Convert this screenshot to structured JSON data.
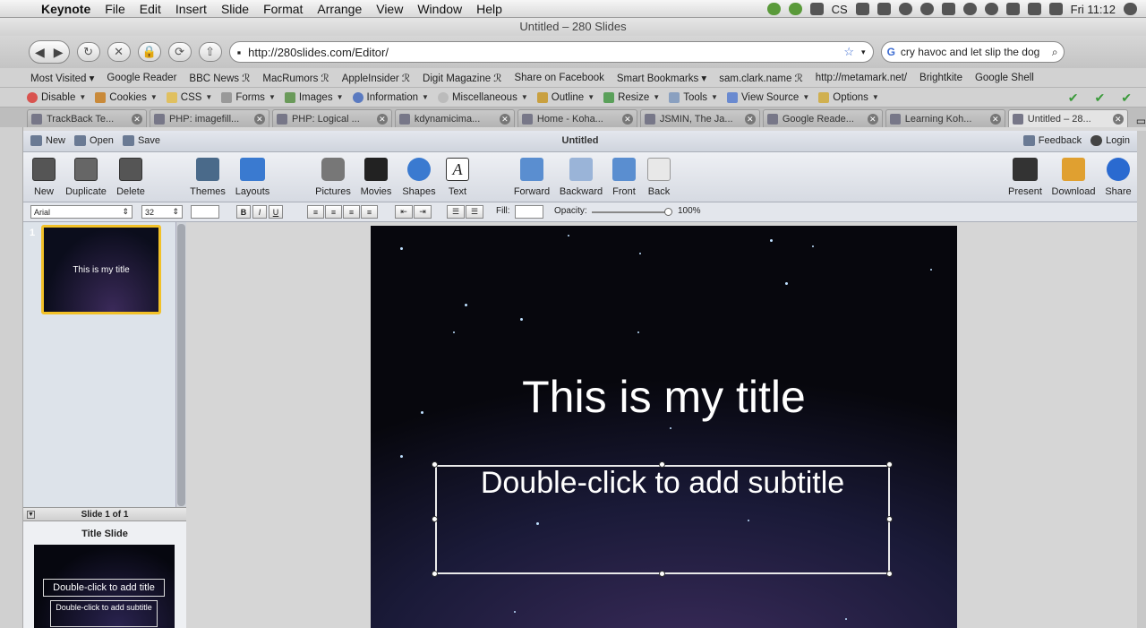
{
  "menubar": {
    "app": "Keynote",
    "items": [
      "File",
      "Edit",
      "Insert",
      "Slide",
      "Format",
      "Arrange",
      "View",
      "Window",
      "Help"
    ],
    "status_text": "CS",
    "clock": "Fri 11:12"
  },
  "window": {
    "title": "Untitled – 280 Slides"
  },
  "nav": {
    "url": "http://280slides.com/Editor/",
    "search_value": "cry havoc and let slip the dog"
  },
  "bookmarks": [
    "Most Visited ▾",
    "Google Reader",
    "BBC News ℛ",
    "MacRumors ℛ",
    "AppleInsider ℛ",
    "Digit Magazine ℛ",
    "Share on Facebook",
    "Smart Bookmarks ▾",
    "sam.clark.name ℛ",
    "http://metamark.net/",
    "Brightkite",
    "Google Shell"
  ],
  "devbar": [
    "Disable",
    "Cookies",
    "CSS",
    "Forms",
    "Images",
    "Information",
    "Miscellaneous",
    "Outline",
    "Resize",
    "Tools",
    "View Source",
    "Options"
  ],
  "tabs": [
    "TrackBack Te...",
    "PHP: imagefill...",
    "PHP: Logical ...",
    "kdynamicima...",
    "Home - Koha...",
    "JSMIN, The Ja...",
    "Google Reade...",
    "Learning Koh...",
    "Untitled – 28..."
  ],
  "app": {
    "new_label": "New",
    "open_label": "Open",
    "save_label": "Save",
    "doc_title": "Untitled",
    "feedback_label": "Feedback",
    "login_label": "Login"
  },
  "toolbar": {
    "new": "New",
    "duplicate": "Duplicate",
    "delete": "Delete",
    "themes": "Themes",
    "layouts": "Layouts",
    "pictures": "Pictures",
    "movies": "Movies",
    "shapes": "Shapes",
    "text": "Text",
    "forward": "Forward",
    "backward": "Backward",
    "front": "Front",
    "back": "Back",
    "present": "Present",
    "download": "Download",
    "share": "Share"
  },
  "format": {
    "font": "Arial",
    "size": "32",
    "bold": "B",
    "italic": "I",
    "underline": "U",
    "fill_label": "Fill:",
    "opacity_label": "Opacity:",
    "opacity_value": "100%",
    "opacity_fraction": 1.0
  },
  "slides_panel": {
    "slide_number": "1",
    "thumb_title": "This is my title",
    "counter": "Slide 1 of 1"
  },
  "theme_panel": {
    "title": "Title Slide",
    "thumb_title": "Double-click to add title",
    "thumb_subtitle": "Double-click to add subtitle"
  },
  "slide": {
    "title": "This is my title",
    "subtitle": "Double-click to add subtitle"
  },
  "colors": {
    "selection": "#f2c128",
    "slide_bg": "#0b0d1c"
  }
}
